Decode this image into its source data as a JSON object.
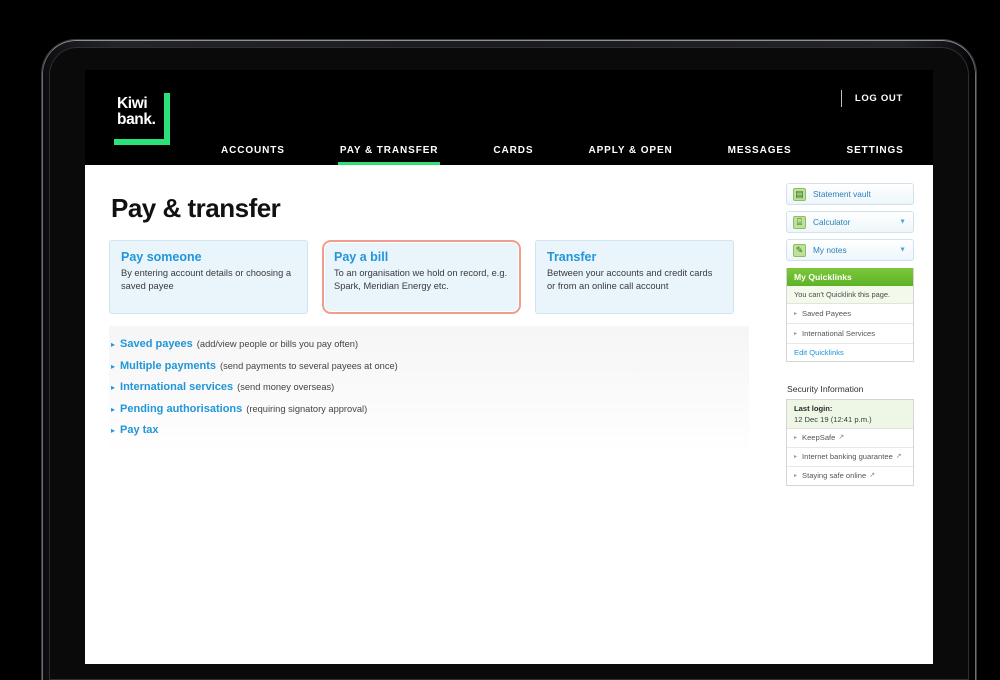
{
  "device": {
    "type": "tablet-frame"
  },
  "header": {
    "logo": {
      "line1": "Kiwi",
      "line2": "bank.",
      "name": "kiwibank-logo"
    },
    "logout_label": "LOG OUT",
    "nav": [
      {
        "label": "ACCOUNTS",
        "active": false
      },
      {
        "label": "PAY & TRANSFER",
        "active": true
      },
      {
        "label": "CARDS",
        "active": false
      },
      {
        "label": "APPLY & OPEN",
        "active": false
      },
      {
        "label": "MESSAGES",
        "active": false
      },
      {
        "label": "SETTINGS",
        "active": false
      }
    ]
  },
  "page": {
    "title": "Pay & transfer",
    "cards": [
      {
        "title": "Pay someone",
        "desc": "By entering account details or choosing a saved payee",
        "selected": false
      },
      {
        "title": "Pay a bill",
        "desc": "To an organisation we hold on record, e.g. Spark, Meridian Energy etc.",
        "selected": true
      },
      {
        "title": "Transfer",
        "desc": "Between your accounts and credit cards or from an online call account",
        "selected": false
      }
    ],
    "links": [
      {
        "label": "Saved payees",
        "note": "(add/view people or bills you pay often)"
      },
      {
        "label": "Multiple payments",
        "note": "(send payments to several payees at once)"
      },
      {
        "label": "International services",
        "note": "(send money overseas)"
      },
      {
        "label": "Pending authorisations",
        "note": "(requiring signatory approval)"
      },
      {
        "label": "Pay tax",
        "note": ""
      }
    ]
  },
  "sidebar": {
    "tools": [
      {
        "label": "Statement vault",
        "icon": "statement-vault-icon",
        "glyph": "▤",
        "chevron": false
      },
      {
        "label": "Calculator",
        "icon": "calculator-icon",
        "glyph": "⌸",
        "chevron": true
      },
      {
        "label": "My notes",
        "icon": "notes-icon",
        "glyph": "✎",
        "chevron": true
      }
    ],
    "quicklinks": {
      "title": "My Quicklinks",
      "note": "You can't Quicklink this page.",
      "items": [
        "Saved Payees",
        "International Services"
      ],
      "edit_label": "Edit Quicklinks"
    },
    "security": {
      "title": "Security Information",
      "last_login_label": "Last login:",
      "last_login_value": "12 Dec 19 (12:41 p.m.)",
      "items": [
        {
          "label": "KeepSafe",
          "external": true
        },
        {
          "label": "Internet banking guarantee",
          "external": true
        },
        {
          "label": "Staying safe online",
          "external": true
        }
      ]
    }
  },
  "colors": {
    "brand_green": "#2ce07a",
    "link_blue": "#2196d8",
    "card_bg": "#e9f5fb",
    "selected_border": "#f09c8e",
    "quicklinks_green": "#5cb226"
  }
}
